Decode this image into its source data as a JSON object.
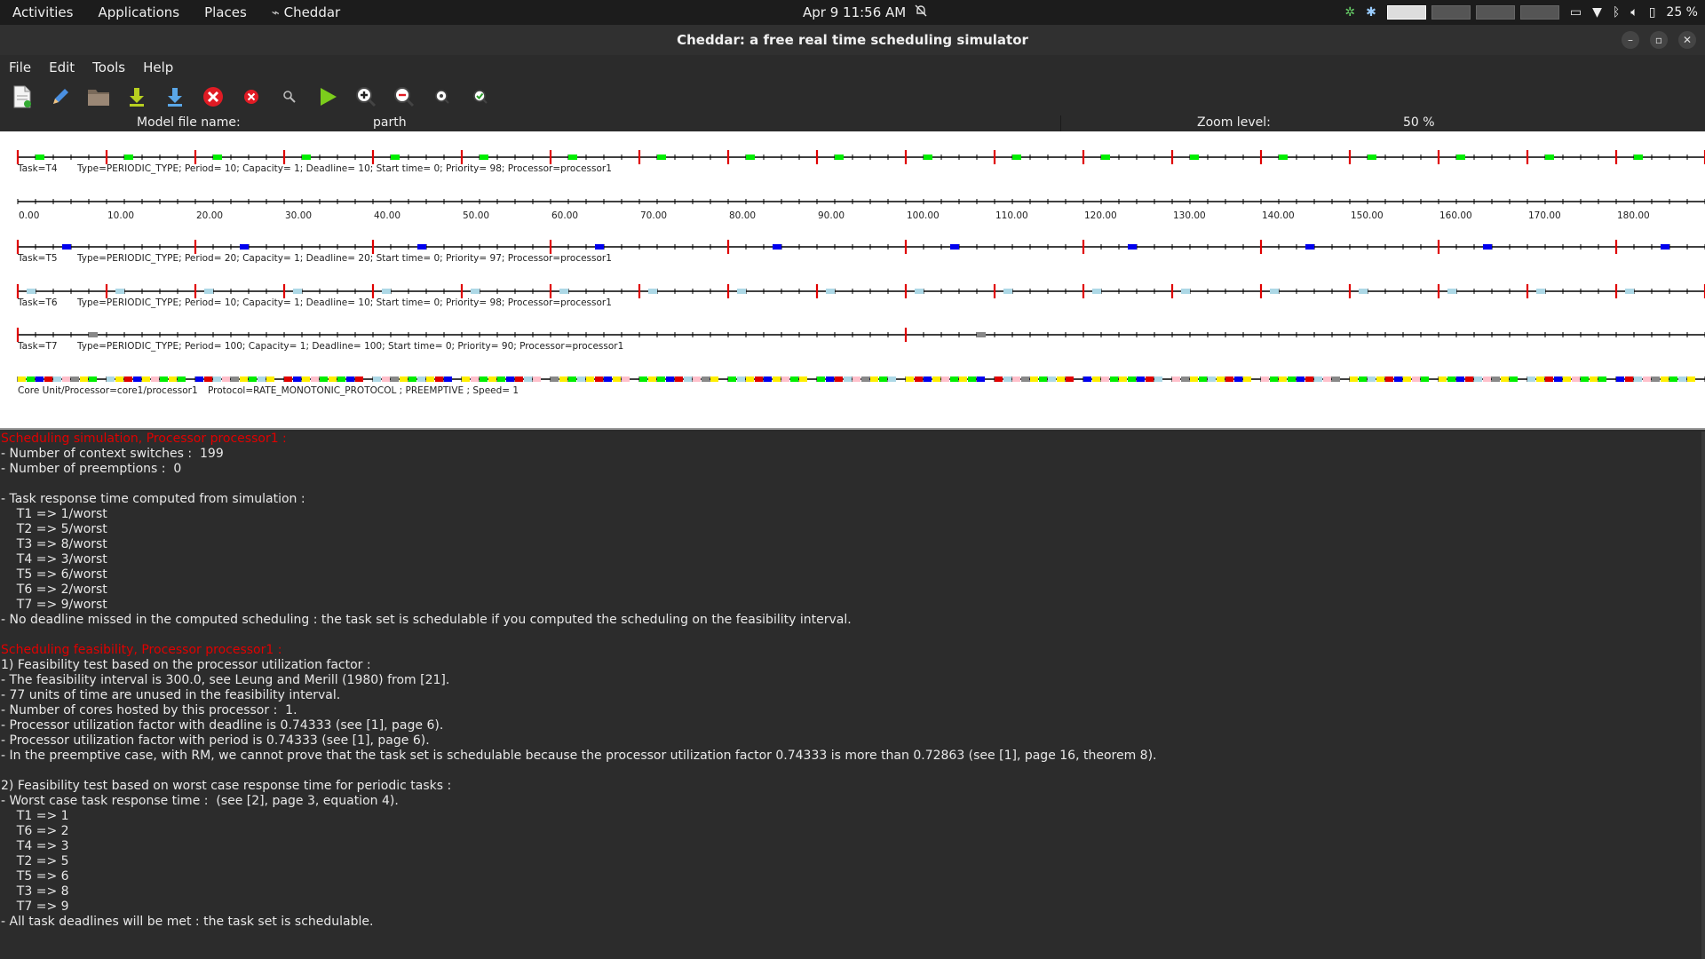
{
  "topbar": {
    "activities": "Activities",
    "applications": "Applications",
    "places": "Places",
    "app_name": "Cheddar",
    "clock": "Apr 9  11:56 AM",
    "battery": "25 %"
  },
  "window": {
    "title": "Cheddar: a free real time scheduling simulator"
  },
  "menu": [
    "File",
    "Edit",
    "Tools",
    "Help"
  ],
  "toolbar": [
    "new-file",
    "edit",
    "open-folder",
    "save",
    "save-as",
    "close",
    "delete",
    "search",
    "run",
    "zoom-in",
    "zoom-out",
    "zoom-fit",
    "check"
  ],
  "modelbar": {
    "model_label": "Model file name:",
    "model_value": "parth",
    "zoom_label": "Zoom level:",
    "zoom_value": "50 %"
  },
  "timeline": {
    "time_labels": [
      "0.00",
      "10.00",
      "20.00",
      "30.00",
      "40.00",
      "50.00",
      "60.00",
      "70.00",
      "80.00",
      "90.00",
      "100.00",
      "110.00",
      "120.00",
      "130.00",
      "140.00",
      "150.00",
      "160.00",
      "170.00",
      "180.00"
    ],
    "tasks": [
      {
        "name": "Task=T4",
        "info": "Type=PERIODIC_TYPE; Period= 10; Capacity= 1; Deadline= 10; Start time= 0; Priority= 98; Processor=processor1",
        "period": 10,
        "color": "#00ee00"
      },
      {
        "name": "Task=T5",
        "info": "Type=PERIODIC_TYPE; Period= 20; Capacity= 1; Deadline= 20; Start time= 0; Priority= 97; Processor=processor1",
        "period": 20,
        "color": "#0000ee"
      },
      {
        "name": "Task=T6",
        "info": "Type=PERIODIC_TYPE; Period= 10; Capacity= 1; Deadline= 10; Start time= 0; Priority= 98; Processor=processor1",
        "period": 10,
        "color": "#add8e6"
      },
      {
        "name": "Task=T7",
        "info": "Type=PERIODIC_TYPE; Period= 100; Capacity= 1; Deadline= 100; Start time= 0; Priority= 90; Processor=processor1",
        "period": 100,
        "color": "#888888"
      }
    ],
    "core": {
      "name": "Core Unit/Processor=core1/processor1",
      "protocol": "Protocol=RATE_MONOTONIC_PROTOCOL ; PREEMPTIVE ; Speed= 1"
    }
  },
  "output": [
    {
      "t": "Scheduling simulation, Processor processor1 :",
      "h": true
    },
    {
      "t": "- Number of context switches :  199"
    },
    {
      "t": "- Number of preemptions :  0"
    },
    {
      "t": ""
    },
    {
      "t": "- Task response time computed from simulation :"
    },
    {
      "t": "    T1 => 1/worst"
    },
    {
      "t": "    T2 => 5/worst"
    },
    {
      "t": "    T3 => 8/worst"
    },
    {
      "t": "    T4 => 3/worst"
    },
    {
      "t": "    T5 => 6/worst"
    },
    {
      "t": "    T6 => 2/worst"
    },
    {
      "t": "    T7 => 9/worst"
    },
    {
      "t": "- No deadline missed in the computed scheduling : the task set is schedulable if you computed the scheduling on the feasibility interval."
    },
    {
      "t": ""
    },
    {
      "t": "Scheduling feasibility, Processor processor1 :",
      "h": true
    },
    {
      "t": "1) Feasibility test based on the processor utilization factor :"
    },
    {
      "t": "- The feasibility interval is 300.0, see Leung and Merill (1980) from [21]."
    },
    {
      "t": "- 77 units of time are unused in the feasibility interval."
    },
    {
      "t": "- Number of cores hosted by this processor :  1."
    },
    {
      "t": "- Processor utilization factor with deadline is 0.74333 (see [1], page 6)."
    },
    {
      "t": "- Processor utilization factor with period is 0.74333 (see [1], page 6)."
    },
    {
      "t": "- In the preemptive case, with RM, we cannot prove that the task set is schedulable because the processor utilization factor 0.74333 is more than 0.72863 (see [1], page 16, theorem 8)."
    },
    {
      "t": ""
    },
    {
      "t": "2) Feasibility test based on worst case response time for periodic tasks :"
    },
    {
      "t": "- Worst case task response time :  (see [2], page 3, equation 4)."
    },
    {
      "t": "    T1 => 1"
    },
    {
      "t": "    T6 => 2"
    },
    {
      "t": "    T4 => 3"
    },
    {
      "t": "    T2 => 5"
    },
    {
      "t": "    T5 => 6"
    },
    {
      "t": "    T3 => 8"
    },
    {
      "t": "    T7 => 9"
    },
    {
      "t": "- All task deadlines will be met : the task set is schedulable."
    }
  ]
}
